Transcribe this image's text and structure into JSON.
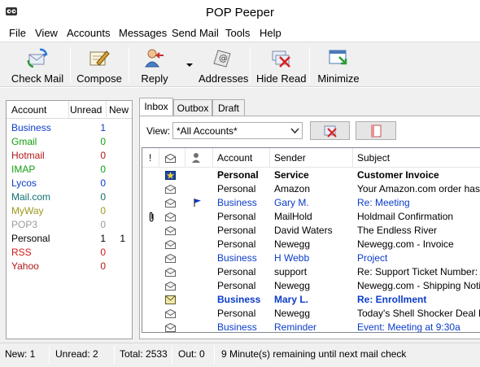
{
  "window": {
    "title": "POP Peeper"
  },
  "menu": [
    "File",
    "View",
    "Accounts",
    "Messages",
    "Send Mail",
    "Tools",
    "Help"
  ],
  "toolbar": {
    "check_mail": "Check Mail",
    "compose": "Compose",
    "reply": "Reply",
    "addresses": "Addresses",
    "hide_read": "Hide Read",
    "minimize": "Minimize"
  },
  "accounts_pane": {
    "headers": {
      "account": "Account",
      "unread": "Unread",
      "new": "New"
    },
    "rows": [
      {
        "name": "Business",
        "unread": "1",
        "new": "",
        "color": "#0a3cc8"
      },
      {
        "name": "Gmail",
        "unread": "0",
        "new": "",
        "color": "#12a012"
      },
      {
        "name": "Hotmail",
        "unread": "0",
        "new": "",
        "color": "#b01818"
      },
      {
        "name": "IMAP",
        "unread": "0",
        "new": "",
        "color": "#12a012"
      },
      {
        "name": "Lycos",
        "unread": "0",
        "new": "",
        "color": "#0a3cc8"
      },
      {
        "name": "Mail.com",
        "unread": "0",
        "new": "",
        "color": "#127070"
      },
      {
        "name": "MyWay",
        "unread": "0",
        "new": "",
        "color": "#9a9a20"
      },
      {
        "name": "POP3",
        "unread": "0",
        "new": "",
        "color": "#9a9a9a"
      },
      {
        "name": "Personal",
        "unread": "1",
        "new": "1",
        "color": "#000000"
      },
      {
        "name": "RSS",
        "unread": "0",
        "new": "",
        "color": "#d01818"
      },
      {
        "name": "Yahoo",
        "unread": "0",
        "new": "",
        "color": "#b01818"
      }
    ]
  },
  "tabs": [
    "Inbox",
    "Outbox",
    "Draft"
  ],
  "view": {
    "label": "View:",
    "selected": "*All Accounts*"
  },
  "message_list": {
    "headers": {
      "priority": "!",
      "account": "Account",
      "sender": "Sender",
      "subject": "Subject"
    },
    "rows": [
      {
        "account": "Personal",
        "sender": "Service",
        "subject": "Customer Invoice",
        "style": "bold",
        "icon": "new-envelope-icon",
        "attach": false,
        "flag": false
      },
      {
        "account": "Personal",
        "sender": "Amazon",
        "subject": "Your Amazon.com order has shipped",
        "style": "normal",
        "icon": "envelope-icon",
        "attach": false,
        "flag": false
      },
      {
        "account": "Business",
        "sender": "Gary M.",
        "subject": "Re: Meeting",
        "style": "blue",
        "icon": "envelope-icon",
        "attach": false,
        "flag": true
      },
      {
        "account": "Personal",
        "sender": "MailHold",
        "subject": "Holdmail Confirmation",
        "style": "normal",
        "icon": "envelope-icon",
        "attach": true,
        "flag": false
      },
      {
        "account": "Personal",
        "sender": "David Waters",
        "subject": "The Endless River",
        "style": "normal",
        "icon": "envelope-icon",
        "attach": false,
        "flag": false
      },
      {
        "account": "Personal",
        "sender": "Newegg",
        "subject": "Newegg.com - Invoice",
        "style": "normal",
        "icon": "envelope-icon",
        "attach": false,
        "flag": false
      },
      {
        "account": "Business",
        "sender": "H Webb",
        "subject": "Project",
        "style": "blue",
        "icon": "envelope-icon",
        "attach": false,
        "flag": false
      },
      {
        "account": "Personal",
        "sender": "support",
        "subject": "Re: Support Ticket Number: A-F",
        "style": "normal",
        "icon": "envelope-icon",
        "attach": false,
        "flag": false
      },
      {
        "account": "Personal",
        "sender": "Newegg",
        "subject": "Newegg.com - Shipping Notification",
        "style": "normal",
        "icon": "envelope-icon",
        "attach": false,
        "flag": false
      },
      {
        "account": "Business",
        "sender": "Mary L.",
        "subject": "Re: Enrollment",
        "style": "bold-blue",
        "icon": "unread-envelope-icon",
        "attach": false,
        "flag": false
      },
      {
        "account": "Personal",
        "sender": "Newegg",
        "subject": "Today's Shell Shocker Deal Preview",
        "style": "normal",
        "icon": "envelope-icon",
        "attach": false,
        "flag": false
      },
      {
        "account": "Business",
        "sender": "Reminder",
        "subject": "Event: Meeting at 9:30a",
        "style": "blue",
        "icon": "envelope-icon",
        "attach": false,
        "flag": false
      }
    ]
  },
  "statusbar": {
    "new": "New: 1",
    "unread": "Unread: 2",
    "total": "Total: 2533",
    "out": "Out: 0",
    "message": "9 Minute(s) remaining until next mail check"
  },
  "colors": {
    "blue_text": "#0a3cc8",
    "toolbar_bg": "#f0f0f0"
  }
}
